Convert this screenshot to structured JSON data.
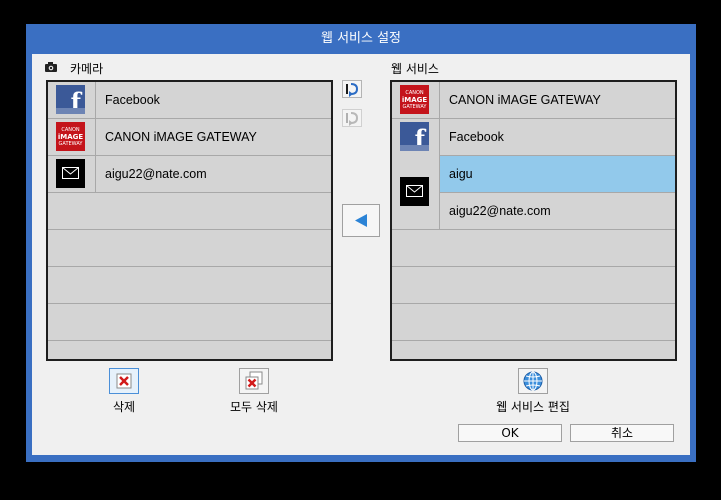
{
  "window": {
    "title": "웹 서비스 설정"
  },
  "camera_panel": {
    "header": "카메라",
    "items": [
      {
        "service": "facebook",
        "label": "Facebook"
      },
      {
        "service": "canon",
        "label": "CANON iMAGE GATEWAY"
      },
      {
        "service": "email",
        "label": "aigu22@nate.com"
      }
    ]
  },
  "web_panel": {
    "header": "웹 서비스",
    "items": [
      {
        "service": "canon",
        "label": "CANON iMAGE GATEWAY"
      },
      {
        "service": "facebook",
        "label": "Facebook"
      },
      {
        "service": "email",
        "label": "aigu",
        "selected": true
      },
      {
        "service": "email",
        "label": "aigu22@nate.com"
      }
    ]
  },
  "icons": {
    "facebook_letter": "f",
    "canon_line1": "CANON",
    "canon_line2": "iMAGE",
    "canon_line3": "GATEWAY"
  },
  "buttons": {
    "delete_label": "삭제",
    "delete_all_label": "모두 삭제",
    "edit_web_services_label": "웹 서비스 편집",
    "ok_label": "OK",
    "cancel_label": "취소"
  },
  "colors": {
    "title_bar": "#3a6fc2",
    "selection": "#92c9eb",
    "facebook": "#3b5998",
    "canon": "#c4141b"
  }
}
